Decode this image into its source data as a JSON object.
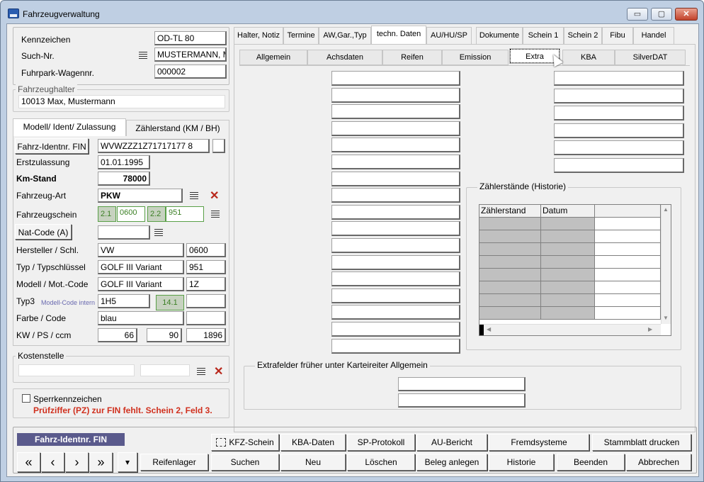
{
  "window": {
    "title": "Fahrzeugverwaltung",
    "min": "▭",
    "max": "▢",
    "close": "✕"
  },
  "vehicle": {
    "kennzeichen_label": "Kennzeichen",
    "kennzeichen": "OD-TL 80",
    "suchnr_label": "Such-Nr.",
    "suchnr": "MUSTERMANN, M",
    "fuhrpark_label": "Fuhrpark-Wagennr.",
    "fuhrpark": "000002"
  },
  "halter": {
    "title": "Fahrzeughalter",
    "value": "10013 Max, Mustermann"
  },
  "left_tabs": {
    "tab1": "Modell/ Ident/ Zulassung",
    "tab2": "Zählerstand (KM / BH)"
  },
  "ident": {
    "fin_button": "Fahrz-Identnr. FIN",
    "fin": "WVWZZZ1Z71717177 8",
    "erstzulassung_label": "Erstzulassung",
    "erstzulassung": "01.01.1995",
    "kmstand_label": "Km-Stand",
    "kmstand": "78000",
    "art_label": "Fahrzeug-Art",
    "art": "PKW",
    "schein_label": "Fahrzeugschein",
    "s21": "2.1",
    "s21_val": "0600",
    "s22": "2.2",
    "s22_val": "951",
    "natcode_button": "Nat-Code (A)",
    "hersteller_label": "Hersteller / Schl.",
    "hersteller": "VW",
    "hersteller_schl": "0600",
    "typ_label": "Typ / Typschlüssel",
    "typ": "GOLF III Variant",
    "typ_schl": "951",
    "modell_label": "Modell / Mot.-Code",
    "modell": "GOLF III Variant",
    "motcode": "1Z",
    "typ3_label": "Typ3",
    "modellcode_label": "Modell-Code intern",
    "typ3": "1H5",
    "typ3_code": "14.1",
    "farbe_label": "Farbe / Code",
    "farbe": "blau",
    "kw_label": "KW / PS / ccm",
    "kw": "66",
    "ps": "90",
    "ccm": "1896"
  },
  "kosten": {
    "title": "Kostenstelle"
  },
  "sperr": {
    "label": "Sperrkennzeichen",
    "warning": "Prüfziffer (PZ) zur FIN fehlt. Schein 2, Feld 3."
  },
  "top_tabs": [
    "Halter, Notiz",
    "Termine",
    "AW,Gar.,Typ",
    "techn. Daten",
    "AU/HU/SP",
    "Dokumente",
    "Schein 1",
    "Schein 2",
    "Fibu",
    "Handel"
  ],
  "sub_tabs": [
    "Allgemein",
    "Achsdaten",
    "Reifen",
    "Emission",
    "Extra",
    "KBA",
    "SilverDAT"
  ],
  "historie": {
    "title": "Zählerstände (Historie)",
    "col1": "Zählerstand",
    "col2": "Datum"
  },
  "extrafelder": {
    "title": "Extrafelder früher unter Karteireiter Allgemein"
  },
  "bottom": {
    "status": "Fahrz-Identnr. FIN",
    "kfz_schein": "KFZ-Schein",
    "kba_daten": "KBA-Daten",
    "sp_protokoll": "SP-Protokoll",
    "au_bericht": "AU-Bericht",
    "fremdsysteme": "Fremdsysteme",
    "stammblatt": "Stammblatt drucken",
    "reifenlager": "Reifenlager",
    "suchen": "Suchen",
    "neu": "Neu",
    "loeschen": "Löschen",
    "beleg": "Beleg anlegen",
    "historie": "Historie",
    "beenden": "Beenden",
    "abbrechen": "Abbrechen",
    "nav_first": "«",
    "nav_prev": "‹",
    "nav_next": "›",
    "nav_last": "»",
    "nav_menu": "▾"
  },
  "colors": {
    "warning": "#d0301e",
    "title_bg": "#bfcfe3",
    "status_bg": "#5a5a8c"
  }
}
